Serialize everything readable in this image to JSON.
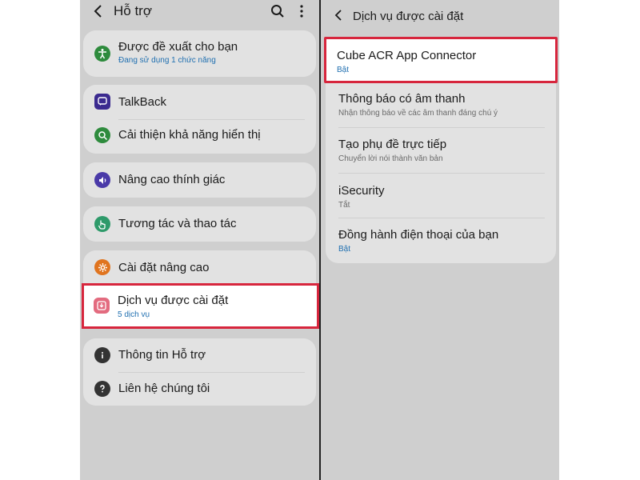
{
  "left": {
    "header_title": "Hỗ trợ",
    "search_icon": "search-icon",
    "more_icon": "more-vertical-icon",
    "items": [
      {
        "label": "Được đề xuất cho bạn",
        "subtitle": "Đang sử dụng 1 chức năng",
        "icon": "accessibility-icon",
        "color": "#2e8b3d"
      },
      {
        "label": "TalkBack",
        "icon": "talkback-icon",
        "color": "#3b2a8f"
      },
      {
        "label": "Cải thiện khả năng hiển thị",
        "icon": "visibility-zoom-icon",
        "color": "#2e8b3d"
      },
      {
        "label": "Nâng cao thính giác",
        "icon": "hearing-icon",
        "color": "#4a3aa8"
      },
      {
        "label": "Tương tác và thao tác",
        "icon": "touch-icon",
        "color": "#2e9a6a"
      },
      {
        "label": "Cài đặt nâng cao",
        "icon": "advanced-settings-icon",
        "color": "#e0741f"
      },
      {
        "label": "Dịch vụ được cài đặt",
        "subtitle": "5 dịch vụ",
        "icon": "installed-services-icon",
        "color": "#e36b7f"
      },
      {
        "label": "Thông tin Hỗ trợ",
        "icon": "info-icon",
        "color": "#333333"
      },
      {
        "label": "Liên hệ chúng tôi",
        "icon": "help-icon",
        "color": "#333333"
      }
    ]
  },
  "right": {
    "header_title": "Dịch vụ được cài đặt",
    "items": [
      {
        "label": "Cube ACR App Connector",
        "subtitle": "Bật"
      },
      {
        "label": "Thông báo có âm thanh",
        "subtitle": "Nhận thông báo về các âm thanh đáng chú ý"
      },
      {
        "label": "Tạo phụ đề trực tiếp",
        "subtitle": "Chuyển lời nói thành văn bản"
      },
      {
        "label": "iSecurity",
        "subtitle": "Tắt"
      },
      {
        "label": "Đồng hành điện thoại của bạn",
        "subtitle": "Bật"
      }
    ]
  },
  "colors": {
    "highlight_border": "#d7263d",
    "subtitle_blue": "#1f6fb0",
    "panel_bg": "#cfcfcf",
    "card_bg": "#e2e2e2"
  }
}
